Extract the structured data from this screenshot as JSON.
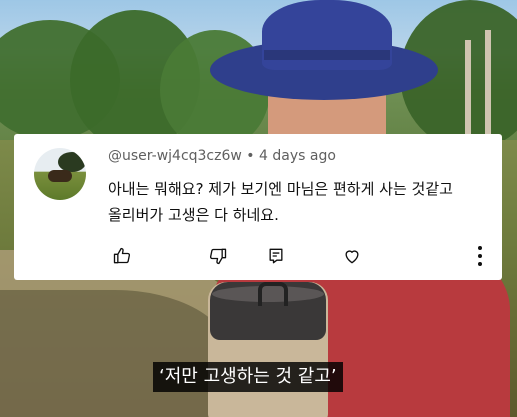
{
  "comment": {
    "username": "@user-wj4cq3cz6w",
    "separator": "•",
    "timestamp": "4 days ago",
    "text_line1": "아내는 뭐해요? 제가 보기엔 마님은 편하게 사는 것같고",
    "text_line2": "올리버가 고생은 다 하네요.",
    "icons": [
      "thumbs-up-icon",
      "thumbs-down-icon",
      "reply-icon",
      "heart-icon",
      "more-vert-icon"
    ]
  },
  "subtitle": {
    "text": "‘저만 고생하는 것 같고’"
  },
  "colors": {
    "card_bg": "#ffffff",
    "meta_text": "#606060",
    "body_text": "#0f0f0f",
    "hat": "#34449a",
    "shirt": "#b83a3e"
  }
}
